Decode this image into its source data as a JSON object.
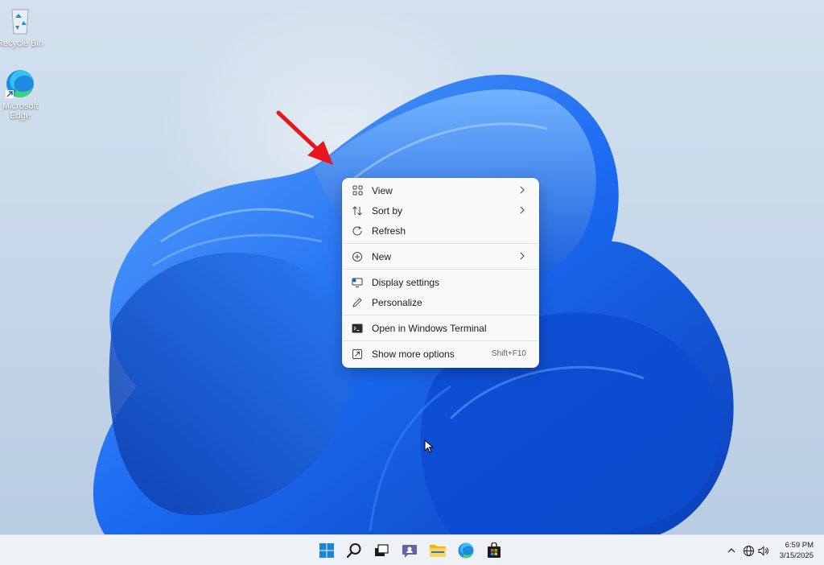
{
  "desktop": {
    "icons": [
      {
        "label": "Recycle Bin",
        "icon": "recycle-bin-icon"
      },
      {
        "label": "Microsoft Edge",
        "icon": "edge-icon"
      }
    ],
    "annotation": {
      "icon": "red-arrow-icon",
      "color": "#e8161c"
    }
  },
  "context_menu": {
    "items": [
      {
        "label": "View",
        "icon": "view-grid-icon",
        "submenu": true
      },
      {
        "label": "Sort by",
        "icon": "sort-icon",
        "submenu": true
      },
      {
        "label": "Refresh",
        "icon": "refresh-icon",
        "submenu": false
      },
      {
        "label": "New",
        "icon": "new-plus-icon",
        "submenu": true
      },
      {
        "label": "Display settings",
        "icon": "display-icon",
        "submenu": false
      },
      {
        "label": "Personalize",
        "icon": "pencil-icon",
        "submenu": false
      },
      {
        "label": "Open in Windows Terminal",
        "icon": "terminal-icon",
        "submenu": false
      },
      {
        "label": "Show more options",
        "icon": "more-options-icon",
        "shortcut": "Shift+F10"
      }
    ]
  },
  "taskbar": {
    "apps": [
      "start-icon",
      "search-icon",
      "task-view-icon",
      "chat-icon",
      "file-explorer-icon",
      "edge-icon",
      "store-icon"
    ],
    "tray": [
      "chevron-up-icon",
      "network-icon",
      "volume-icon"
    ],
    "clock": {
      "time": "6:59 PM",
      "date": "3/15/2025"
    }
  },
  "colors": {
    "wallpaper_blue": "#1f6fe8",
    "accent": "#0067c0"
  }
}
